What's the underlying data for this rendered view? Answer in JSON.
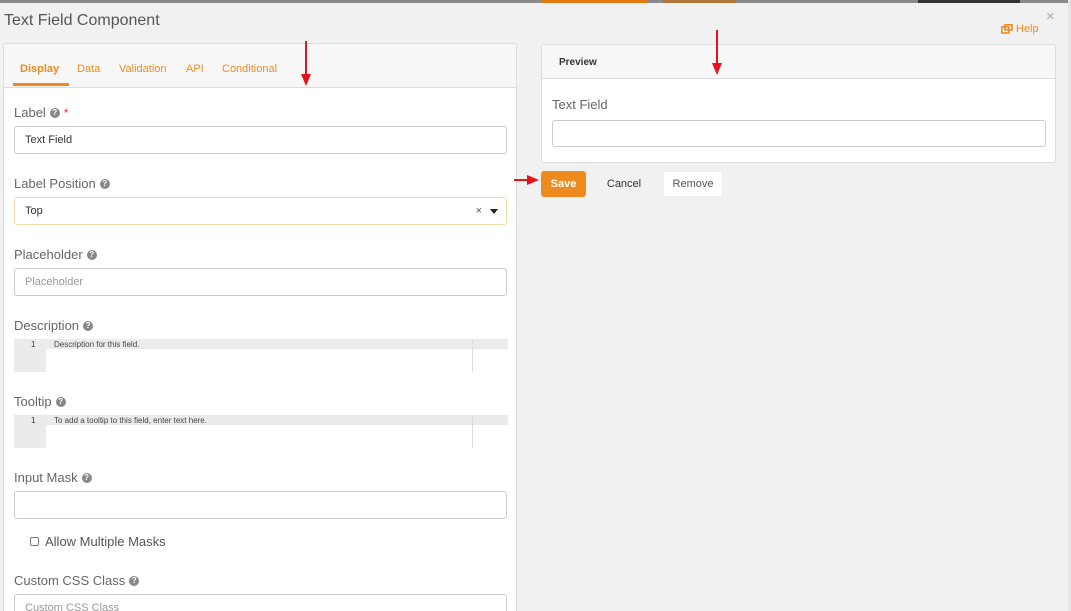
{
  "modal": {
    "title": "Text Field Component",
    "help_label": "Help",
    "close_label": "×"
  },
  "tabs": [
    {
      "label": "Display",
      "active": true
    },
    {
      "label": "Data",
      "active": false
    },
    {
      "label": "Validation",
      "active": false
    },
    {
      "label": "API",
      "active": false
    },
    {
      "label": "Conditional",
      "active": false
    }
  ],
  "form": {
    "label": {
      "label": "Label",
      "required_mark": "*",
      "value": "Text Field"
    },
    "label_position": {
      "label": "Label Position",
      "value": "Top",
      "clear": "×"
    },
    "placeholder": {
      "label": "Placeholder",
      "placeholder": "Placeholder"
    },
    "description": {
      "label": "Description",
      "line_number": "1",
      "placeholder": "Description for this field."
    },
    "tooltip": {
      "label": "Tooltip",
      "line_number": "1",
      "placeholder": "To add a tooltip to this field, enter text here."
    },
    "input_mask": {
      "label": "Input Mask",
      "value": ""
    },
    "allow_multiple_masks": {
      "label": "Allow Multiple Masks",
      "checked": false
    },
    "custom_css_class": {
      "label": "Custom CSS Class",
      "placeholder": "Custom CSS Class"
    }
  },
  "preview": {
    "title": "Preview",
    "field_label": "Text Field",
    "field_value": ""
  },
  "actions": {
    "save": "Save",
    "cancel": "Cancel",
    "remove": "Remove"
  },
  "colors": {
    "accent": "#f08a1f",
    "annotation_arrow": "#e8121b"
  },
  "icons": [
    "question-circle-icon",
    "external-window-icon",
    "close-icon",
    "caret-down-icon",
    "annotation-arrow-icon"
  ]
}
